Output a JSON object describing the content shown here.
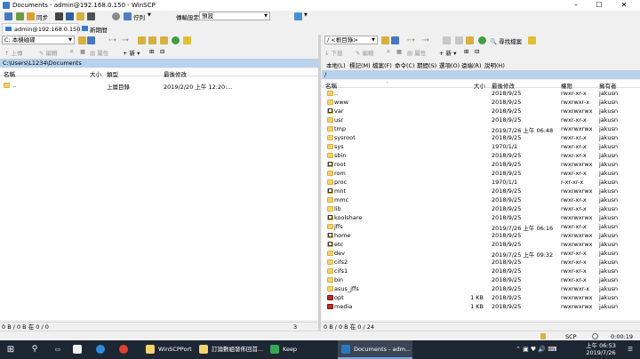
{
  "window": {
    "title": "Documents - admin@192.168.0.150 - WinSCP"
  },
  "toolbar": {
    "sync_label": "同步",
    "queue_label": "佇列",
    "transfer_label": "傳輸設定",
    "transfer_value": "預設"
  },
  "session": {
    "tab_label": "admin@192.168.0.150",
    "new_tab_label": "新期間"
  },
  "left": {
    "drive": "C: 本機磁碟",
    "ops": {
      "upload": "上傳",
      "edit": "編輯",
      "props": "屬性",
      "new": "新"
    },
    "path": "C:\\Users\\L1234\\Documents",
    "headers": {
      "name": "名稱",
      "size": "大小",
      "type": "類型",
      "modified": "最後修改"
    },
    "files": [
      {
        "name": "..",
        "size": "",
        "type": "上層目錄",
        "modified": "2019/2/20  上午 12:20:..."
      }
    ],
    "status": "0 B / 0 B 在 0 / 0",
    "hidden": "3 hidden"
  },
  "right": {
    "drive": "/ <根目錄>",
    "find_label": "尋找檔案",
    "ops": {
      "download": "下載",
      "edit": "編輯",
      "props": "屬性",
      "new": "新"
    },
    "menu": [
      "本地(L)",
      "標記(M)",
      "檔案(F)",
      "命令(C)",
      "期間(S)",
      "選項(O)",
      "遠端(R)",
      "說明(H)"
    ],
    "path": "/",
    "headers": {
      "name": "名稱",
      "size": "大小",
      "modified": "最後修改",
      "rights": "權限",
      "owner": "擁有者"
    },
    "files": [
      {
        "name": "..",
        "size": "",
        "modified": "2018/9/25",
        "rights": "rwxr-xr-x",
        "owner": "jakusn",
        "icon": "up"
      },
      {
        "name": "www",
        "size": "",
        "modified": "2018/9/25",
        "rights": "rwxrwxr-x",
        "owner": "jakusn",
        "icon": "folder"
      },
      {
        "name": "var",
        "size": "",
        "modified": "2018/9/25",
        "rights": "rwxrwxrwx",
        "owner": "jakusn",
        "icon": "link"
      },
      {
        "name": "usr",
        "size": "",
        "modified": "2018/9/25",
        "rights": "rwxr-xr-x",
        "owner": "jakusn",
        "icon": "folder"
      },
      {
        "name": "tmp",
        "size": "",
        "modified": "2019/7/26  上午 06:48",
        "rights": "rwxrwxrwx",
        "owner": "jakusn",
        "icon": "folder"
      },
      {
        "name": "sysroot",
        "size": "",
        "modified": "2018/9/25",
        "rights": "rwxr-xr-x",
        "owner": "jakusn",
        "icon": "folder"
      },
      {
        "name": "sys",
        "size": "",
        "modified": "1970/1/1",
        "rights": "rwxr-xr-x",
        "owner": "jakusn",
        "icon": "folder"
      },
      {
        "name": "sbin",
        "size": "",
        "modified": "2018/9/25",
        "rights": "rwxr-xr-x",
        "owner": "jakusn",
        "icon": "folder"
      },
      {
        "name": "root",
        "size": "",
        "modified": "2018/9/25",
        "rights": "rwxrwxrwx",
        "owner": "jakusn",
        "icon": "link"
      },
      {
        "name": "rom",
        "size": "",
        "modified": "2018/9/25",
        "rights": "rwxr-xr-x",
        "owner": "jakusn",
        "icon": "folder"
      },
      {
        "name": "proc",
        "size": "",
        "modified": "1970/1/1",
        "rights": "r-xr-xr-x",
        "owner": "jakusn",
        "icon": "folder"
      },
      {
        "name": "mnt",
        "size": "",
        "modified": "2018/9/25",
        "rights": "rwxrwxrwx",
        "owner": "jakusn",
        "icon": "link"
      },
      {
        "name": "mmc",
        "size": "",
        "modified": "2018/9/25",
        "rights": "rwxr-xr-x",
        "owner": "jakusn",
        "icon": "folder"
      },
      {
        "name": "lib",
        "size": "",
        "modified": "2018/9/25",
        "rights": "rwxr-xr-x",
        "owner": "jakusn",
        "icon": "folder"
      },
      {
        "name": "koolshare",
        "size": "",
        "modified": "2018/9/25",
        "rights": "rwxrwxrwx",
        "owner": "jakusn",
        "icon": "link"
      },
      {
        "name": "jffs",
        "size": "",
        "modified": "2019/7/26  上午 06:16",
        "rights": "rwxr-xr-x",
        "owner": "jakusn",
        "icon": "folder"
      },
      {
        "name": "home",
        "size": "",
        "modified": "2018/9/25",
        "rights": "rwxrwxrwx",
        "owner": "jakusn",
        "icon": "link"
      },
      {
        "name": "etc",
        "size": "",
        "modified": "2018/9/25",
        "rights": "rwxrwxrwx",
        "owner": "jakusn",
        "icon": "link"
      },
      {
        "name": "dev",
        "size": "",
        "modified": "2019/7/25  上午 09:32",
        "rights": "rwxr-xr-x",
        "owner": "jakusn",
        "icon": "folder"
      },
      {
        "name": "cifs2",
        "size": "",
        "modified": "2018/9/25",
        "rights": "rwxr-xr-x",
        "owner": "jakusn",
        "icon": "folder"
      },
      {
        "name": "cifs1",
        "size": "",
        "modified": "2018/9/25",
        "rights": "rwxr-xr-x",
        "owner": "jakusn",
        "icon": "folder"
      },
      {
        "name": "bin",
        "size": "",
        "modified": "2018/9/25",
        "rights": "rwxr-xr-x",
        "owner": "jakusn",
        "icon": "folder"
      },
      {
        "name": "asus_jffs",
        "size": "",
        "modified": "2018/9/25",
        "rights": "rwxrwxr-x",
        "owner": "jakusn",
        "icon": "folder"
      },
      {
        "name": "opt",
        "size": "1 KB",
        "modified": "2018/9/25",
        "rights": "rwxrwxrwx",
        "owner": "jakusn",
        "icon": "file"
      },
      {
        "name": "media",
        "size": "1 KB",
        "modified": "2018/9/25",
        "rights": "rwxrwxrwx",
        "owner": "jakusn",
        "icon": "file"
      }
    ],
    "status": "0 B / 0 B 在 0 / 24"
  },
  "footer": {
    "protocol": "SCP",
    "elapsed": "0:00:19"
  },
  "taskbar": {
    "apps": [
      {
        "label": "WinSCPPortable",
        "color": "#f5d36c"
      },
      {
        "label": "訂論數組發佈回首...",
        "color": "#f5d36c"
      },
      {
        "label": "Keep",
        "color": "#34a853"
      },
      {
        "label": "Documents - adm...",
        "color": "#2b78c2"
      }
    ],
    "time": "上午 06:53",
    "date": "2019/7/26"
  },
  "colors": {
    "selected_path": "#b9d1ea",
    "taskbar": "#1d2733",
    "folder": "#f5d36c"
  }
}
